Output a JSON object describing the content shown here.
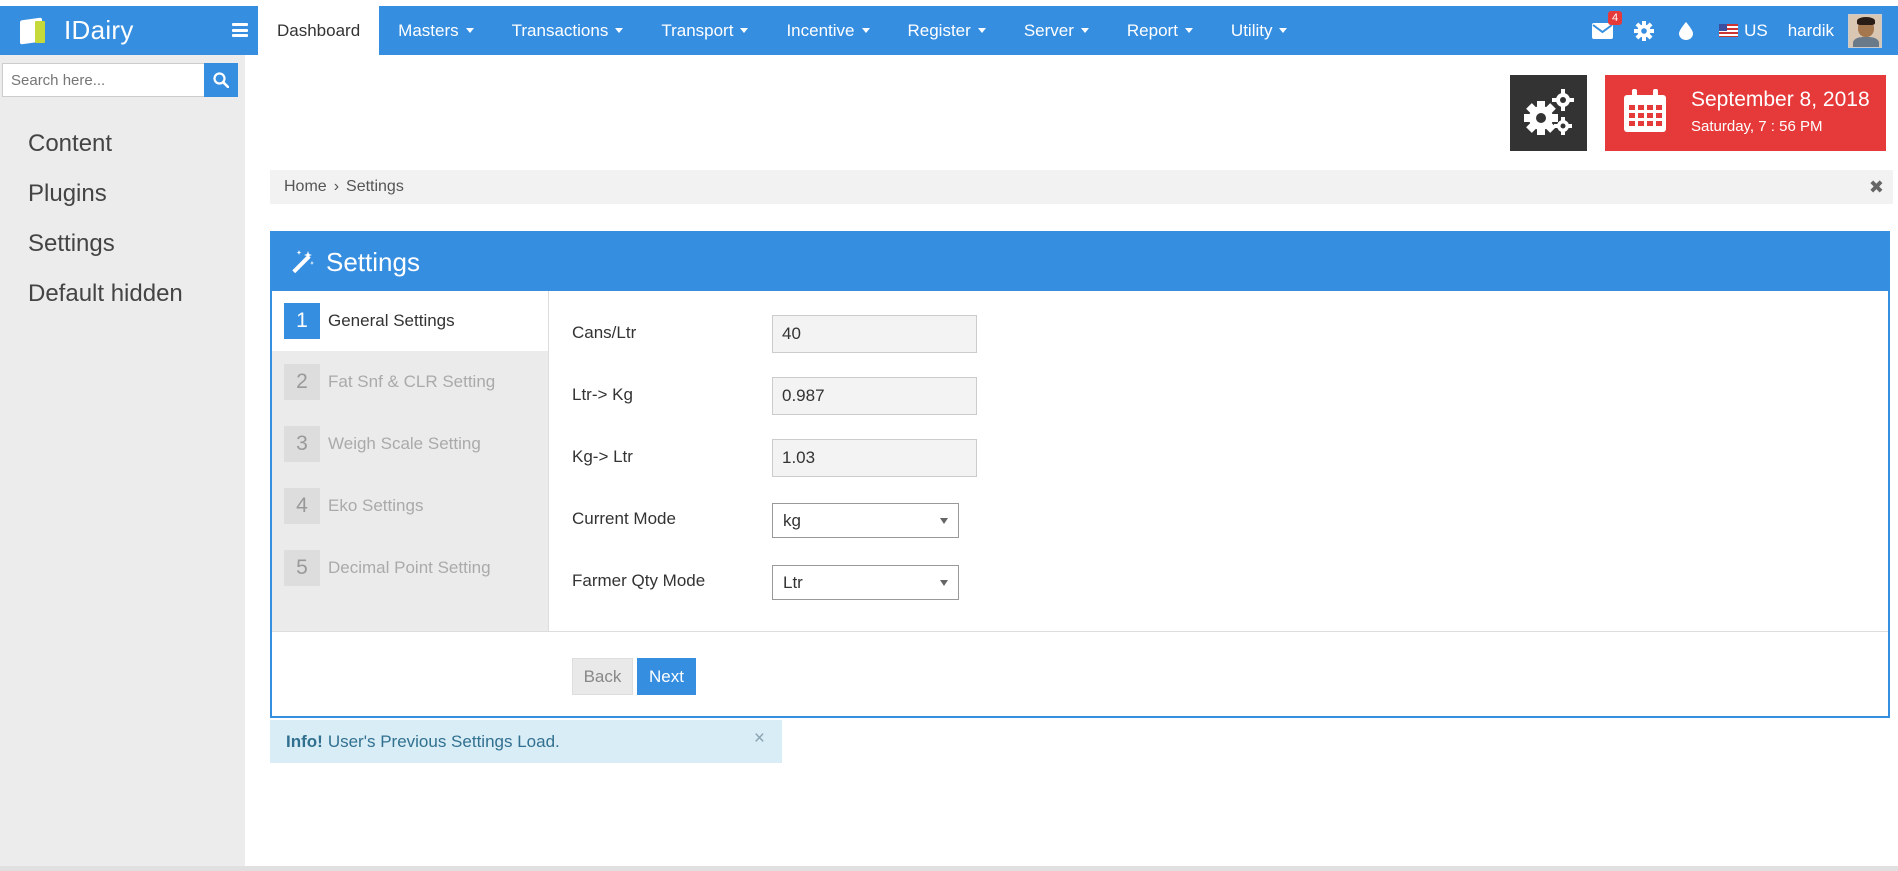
{
  "app": {
    "name": "IDairy"
  },
  "nav": {
    "items": [
      {
        "label": "Dashboard",
        "active": true,
        "caret": false
      },
      {
        "label": "Masters",
        "caret": true
      },
      {
        "label": "Transactions",
        "caret": true
      },
      {
        "label": "Transport",
        "caret": true
      },
      {
        "label": "Incentive",
        "caret": true
      },
      {
        "label": "Register",
        "caret": true
      },
      {
        "label": "Server",
        "caret": true
      },
      {
        "label": "Report",
        "caret": true
      },
      {
        "label": "Utility",
        "caret": true
      }
    ],
    "mail_badge": "4",
    "language": "US",
    "user": "hardik"
  },
  "search": {
    "placeholder": "Search here..."
  },
  "sidebar": {
    "items": [
      {
        "label": "Content"
      },
      {
        "label": "Plugins"
      },
      {
        "label": "Settings"
      },
      {
        "label": "Default hidden"
      }
    ]
  },
  "datebox": {
    "date": "September 8, 2018",
    "time": "Saturday, 7 : 56 PM"
  },
  "breadcrumb": {
    "home": "Home",
    "sep": "›",
    "current": "Settings",
    "close": "✖"
  },
  "panel": {
    "title": "Settings",
    "steps": [
      {
        "num": "1",
        "label": "General Settings"
      },
      {
        "num": "2",
        "label": "Fat Snf & CLR Setting"
      },
      {
        "num": "3",
        "label": "Weigh Scale Setting"
      },
      {
        "num": "4",
        "label": "Eko Settings"
      },
      {
        "num": "5",
        "label": "Decimal Point Setting"
      }
    ],
    "fields": {
      "cans": {
        "label": "Cans/Ltr",
        "value": "40"
      },
      "ltr_kg": {
        "label": "Ltr-> Kg",
        "value": "0.987"
      },
      "kg_ltr": {
        "label": "Kg-> Ltr",
        "value": "1.03"
      },
      "current_mode": {
        "label": "Current Mode",
        "value": "kg"
      },
      "farmer_qty_mode": {
        "label": "Farmer Qty Mode",
        "value": "Ltr"
      }
    },
    "back": "Back",
    "next": "Next"
  },
  "alert": {
    "strong": "Info!",
    "text": "User's Previous Settings Load.",
    "close": "×"
  },
  "colors": {
    "primary": "#368ee0",
    "danger": "#e63a3a",
    "dark": "#333333",
    "info_bg": "#d9edf7"
  }
}
